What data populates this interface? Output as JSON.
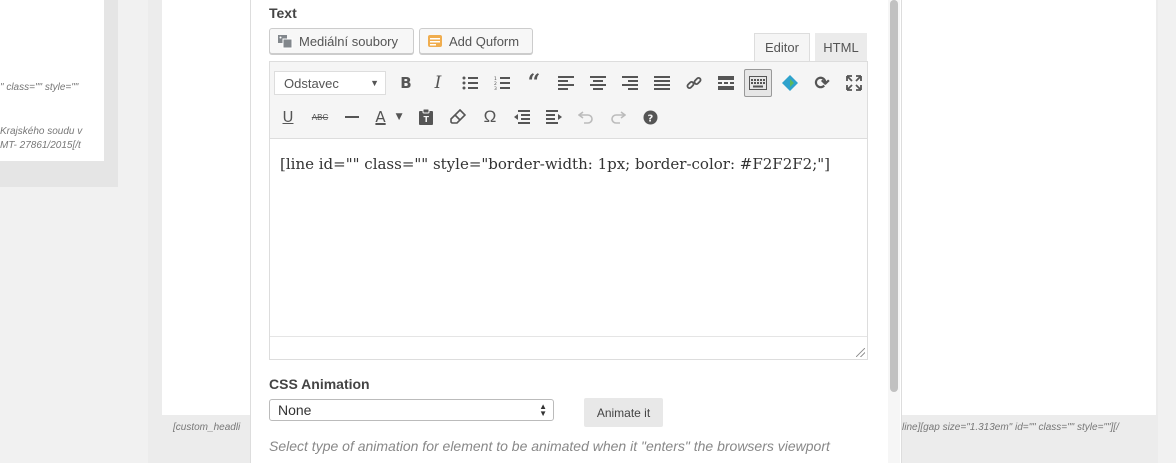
{
  "background": {
    "left_snippet_1": "\" class=\"\" style=\"\"",
    "left_snippet_2": "Krajského soudu v",
    "left_snippet_3": "MT- 27861/2015[/t",
    "bottom_left_snippet": "[custom_headli",
    "bottom_right_snippet": "line][gap size=\"1.313em\" id=\"\" class=\"\" style=\"\"][/"
  },
  "field": {
    "label": "Text"
  },
  "media_buttons": {
    "media_label": "Mediální soubory",
    "quform_label": "Add Quform"
  },
  "editor_tabs": {
    "editor": "Editor",
    "html": "HTML"
  },
  "toolbar": {
    "format_value": "Odstavec",
    "row1_icons": [
      "bold-icon",
      "italic-icon",
      "bullet-list-icon",
      "numbered-list-icon",
      "blockquote-icon",
      "align-left-icon",
      "align-center-icon",
      "align-right-icon",
      "justify-icon",
      "link-icon",
      "read-more-icon",
      "toolbar-toggle-icon",
      "plugin-icon",
      "refresh-icon",
      "fullscreen-icon"
    ],
    "row2_icons": [
      "underline-icon",
      "strikethrough-icon",
      "horizontal-line-icon",
      "text-color-icon",
      "paste-text-icon",
      "clear-formatting-icon",
      "special-character-icon",
      "outdent-icon",
      "indent-icon",
      "undo-icon",
      "redo-icon",
      "help-icon"
    ]
  },
  "editor": {
    "content": "[line id=\"\" class=\"\" style=\"border-width: 1px; border-color: #F2F2F2;\"]"
  },
  "animation": {
    "label": "CSS Animation",
    "selected": "None",
    "animate_button": "Animate it",
    "help_text": "Select type of animation for element to be animated when it \"enters\" the browsers viewport"
  },
  "colors": {
    "accent_blue": "#2ea2cc",
    "plugin_green": "#5cb85c"
  }
}
